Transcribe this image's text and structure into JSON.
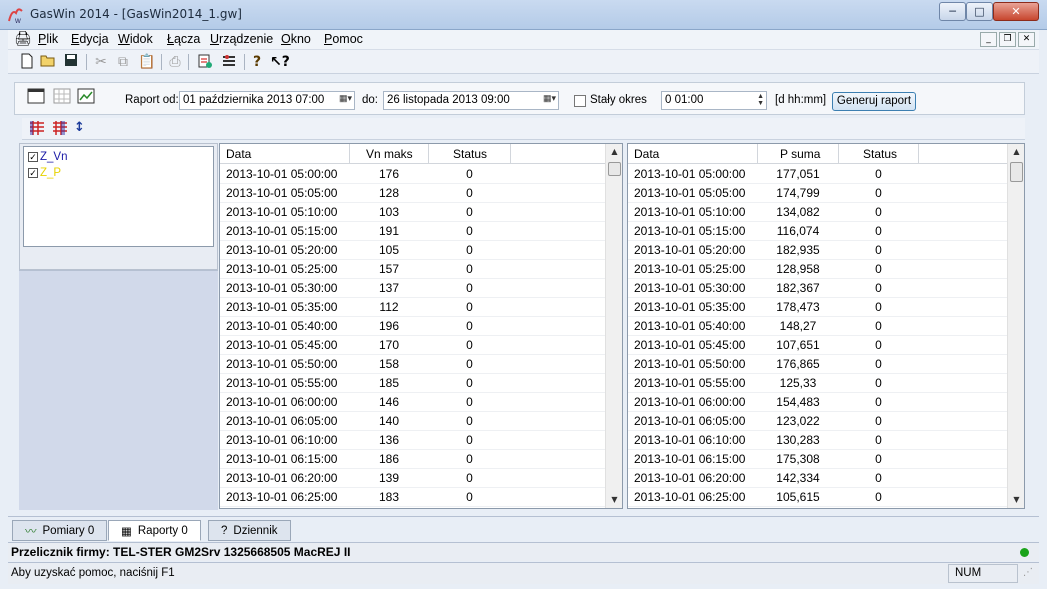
{
  "window": {
    "title": "GasWin 2014 - [GasWin2014_1.gw]",
    "min": "─",
    "max": "□",
    "close": "✕"
  },
  "menu": [
    {
      "label": "Plik",
      "u": "P",
      "rest": "lik"
    },
    {
      "label": "Edycja",
      "u": "E",
      "rest": "dycja"
    },
    {
      "label": "Widok",
      "u": "W",
      "rest": "idok"
    },
    {
      "label": "Łącza",
      "u": "Ł",
      "rest": "ącza"
    },
    {
      "label": "Urządzenie",
      "u": "U",
      "rest": "rządzenie"
    },
    {
      "label": "Okno",
      "u": "O",
      "rest": "kno"
    },
    {
      "label": "Pomoc",
      "u": "P",
      "rest": "omoc"
    }
  ],
  "mdi": {
    "min": "_",
    "restore": "❐",
    "close": "✕"
  },
  "toolbar_icons": [
    "new-file-icon",
    "open-folder-icon",
    "save-icon",
    "cut-icon",
    "copy-icon",
    "paste-icon",
    "print-icon",
    "connect-icon",
    "settings-icon",
    "help-icon",
    "context-help-icon"
  ],
  "report": {
    "from_label": "Raport od:",
    "from_value": "01 października 2013  07:00",
    "to_label": "do:",
    "to_value": "26   listopada   2013  09:00",
    "fixed_label": "Stały okres",
    "period_value": "0   01:00",
    "unit_label": "[d hh:mm]",
    "generate_label": "Generuj raport"
  },
  "tree": [
    {
      "label": "Z_Vn",
      "color": "#1a1aa6",
      "checked": true
    },
    {
      "label": "Z_P",
      "color": "#e6d200",
      "checked": true
    }
  ],
  "table1": {
    "headers": [
      "Data",
      "Vn maks",
      "Status"
    ],
    "rows": [
      [
        "2013-10-01 05:00:00",
        "176",
        "0"
      ],
      [
        "2013-10-01 05:05:00",
        "128",
        "0"
      ],
      [
        "2013-10-01 05:10:00",
        "103",
        "0"
      ],
      [
        "2013-10-01 05:15:00",
        "191",
        "0"
      ],
      [
        "2013-10-01 05:20:00",
        "105",
        "0"
      ],
      [
        "2013-10-01 05:25:00",
        "157",
        "0"
      ],
      [
        "2013-10-01 05:30:00",
        "137",
        "0"
      ],
      [
        "2013-10-01 05:35:00",
        "112",
        "0"
      ],
      [
        "2013-10-01 05:40:00",
        "196",
        "0"
      ],
      [
        "2013-10-01 05:45:00",
        "170",
        "0"
      ],
      [
        "2013-10-01 05:50:00",
        "158",
        "0"
      ],
      [
        "2013-10-01 05:55:00",
        "185",
        "0"
      ],
      [
        "2013-10-01 06:00:00",
        "146",
        "0"
      ],
      [
        "2013-10-01 06:05:00",
        "140",
        "0"
      ],
      [
        "2013-10-01 06:10:00",
        "136",
        "0"
      ],
      [
        "2013-10-01 06:15:00",
        "186",
        "0"
      ],
      [
        "2013-10-01 06:20:00",
        "139",
        "0"
      ],
      [
        "2013-10-01 06:25:00",
        "183",
        "0"
      ]
    ]
  },
  "table2": {
    "headers": [
      "Data",
      "P suma",
      "Status"
    ],
    "rows": [
      [
        "2013-10-01 05:00:00",
        "177,051",
        "0"
      ],
      [
        "2013-10-01 05:05:00",
        "174,799",
        "0"
      ],
      [
        "2013-10-01 05:10:00",
        "134,082",
        "0"
      ],
      [
        "2013-10-01 05:15:00",
        "116,074",
        "0"
      ],
      [
        "2013-10-01 05:20:00",
        "182,935",
        "0"
      ],
      [
        "2013-10-01 05:25:00",
        "128,958",
        "0"
      ],
      [
        "2013-10-01 05:30:00",
        "182,367",
        "0"
      ],
      [
        "2013-10-01 05:35:00",
        "178,473",
        "0"
      ],
      [
        "2013-10-01 05:40:00",
        "148,27",
        "0"
      ],
      [
        "2013-10-01 05:45:00",
        "107,651",
        "0"
      ],
      [
        "2013-10-01 05:50:00",
        "176,865",
        "0"
      ],
      [
        "2013-10-01 05:55:00",
        "125,33",
        "0"
      ],
      [
        "2013-10-01 06:00:00",
        "154,483",
        "0"
      ],
      [
        "2013-10-01 06:05:00",
        "123,022",
        "0"
      ],
      [
        "2013-10-01 06:10:00",
        "130,283",
        "0"
      ],
      [
        "2013-10-01 06:15:00",
        "175,308",
        "0"
      ],
      [
        "2013-10-01 06:20:00",
        "142,334",
        "0"
      ],
      [
        "2013-10-01 06:25:00",
        "105,615",
        "0"
      ]
    ]
  },
  "tabs": [
    {
      "label": "Pomiary 0",
      "icon": "chart-icon",
      "active": false
    },
    {
      "label": "Raporty 0",
      "icon": "report-icon",
      "active": true
    },
    {
      "label": "Dziennik",
      "icon": "log-icon",
      "active": false
    }
  ],
  "firm": "Przelicznik firmy: TEL-STER GM2Srv 1325668505 MacREJ II",
  "status": {
    "help": "Aby uzyskać pomoc, naciśnij F1",
    "num": "NUM",
    "led_color": "#1aa31a"
  }
}
